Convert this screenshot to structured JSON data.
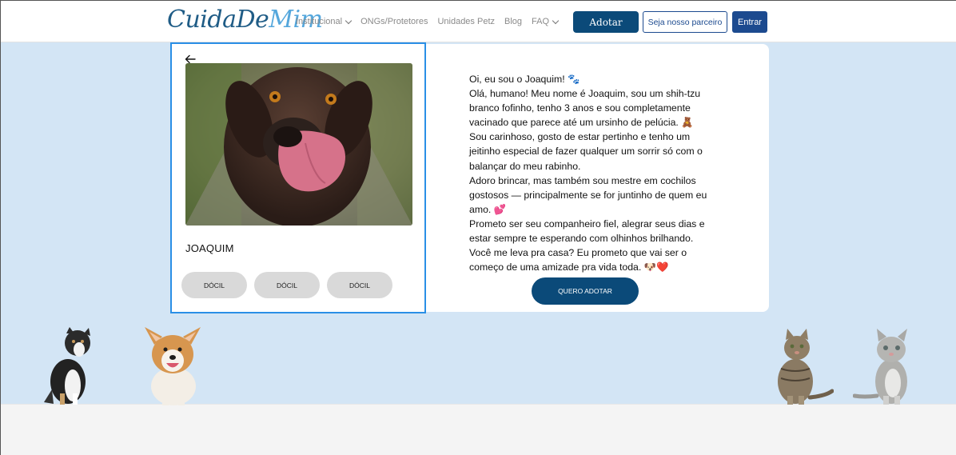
{
  "header": {
    "logo_part1": "CuidaDe",
    "logo_part2": "Mim",
    "nav": [
      {
        "label": "Institucional",
        "has_dropdown": true
      },
      {
        "label": "ONGs/Protetores",
        "has_dropdown": false
      },
      {
        "label": "Unidades Petz",
        "has_dropdown": false
      },
      {
        "label": "Blog",
        "has_dropdown": false
      },
      {
        "label": "FAQ",
        "has_dropdown": true
      }
    ],
    "adotar_label": "Adotar",
    "parceiro_label": "Seja nosso parceiro",
    "entrar_label": "Entrar"
  },
  "pet": {
    "name": "JOAQUIM",
    "tags": [
      "DÓCIL",
      "DÓCIL",
      "DÓCIL"
    ],
    "story": [
      "Oi, eu sou o Joaquim! 🐾",
      "Olá, humano! Meu nome é Joaquim, sou um shih-tzu branco fofinho, tenho 3 anos e sou completamente vacinado que parece até um ursinho de pelúcia. 🧸",
      " Sou carinhoso, gosto de estar pertinho e tenho um jeitinho especial de fazer qualquer um sorrir só com o balançar do meu rabinho.",
      "Adoro brincar, mas também sou mestre em cochilos gostosos — principalmente se for juntinho de quem eu amo. 💕",
      "Prometo ser seu companheiro fiel, alegrar seus dias e estar sempre te esperando com olhinhos brilhando.",
      "Você me leva pra casa? Eu prometo que vai ser o começo de uma amizade pra vida toda. 🐶❤️"
    ],
    "cta_label": "QUERO ADOTAR"
  },
  "colors": {
    "primary": "#0b4a79",
    "accent_blue": "#1c4a8f",
    "band": "#d3e5f5",
    "selection_border": "#2a8fe6"
  }
}
